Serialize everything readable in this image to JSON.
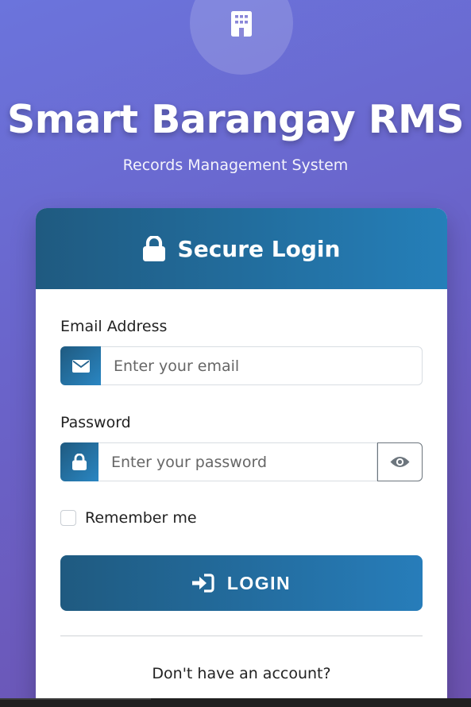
{
  "brand": {
    "logo_icon": "building-icon",
    "title": "Smart Barangay RMS",
    "subtitle": "Records Management System"
  },
  "login_card": {
    "header_icon": "lock-icon",
    "header_title": "Secure Login",
    "email": {
      "label": "Email Address",
      "icon": "envelope-icon",
      "placeholder": "Enter your email",
      "value": ""
    },
    "password": {
      "label": "Password",
      "icon": "lock-icon",
      "placeholder": "Enter your password",
      "value": "",
      "toggle_icon": "eye-icon"
    },
    "remember_me": {
      "label": "Remember me",
      "checked": false
    },
    "login_button": {
      "icon": "sign-in-icon",
      "label": "LOGIN"
    },
    "signup_prompt": "Don't have an account?"
  },
  "colors": {
    "background_gradient_start": "#6b74dc",
    "background_gradient_end": "#6c52b0",
    "primary_dark": "#1f5a80",
    "primary_light": "#277dba"
  }
}
